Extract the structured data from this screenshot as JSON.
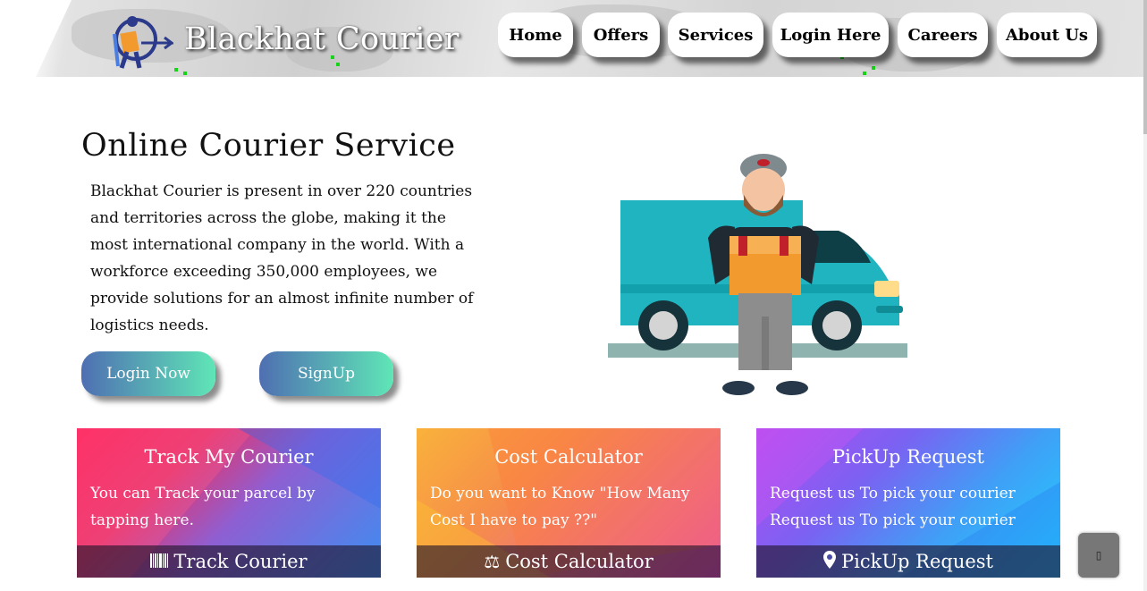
{
  "header": {
    "brand": "Blackhat Courier",
    "logo_icon": "courier-logo-icon",
    "nav": [
      {
        "label": "Home"
      },
      {
        "label": "Offers"
      },
      {
        "label": "Services"
      },
      {
        "label": "Login Here"
      },
      {
        "label": "Careers"
      },
      {
        "label": "About Us"
      }
    ]
  },
  "hero": {
    "title": "Online Courier Service",
    "text": "Blackhat Courier is present in over 220 countries and territories across the globe, making it the most international company in the world. With a workforce exceeding 350,000 employees, we provide solutions for an almost infinite number of logistics needs.",
    "login_label": "Login Now",
    "signup_label": "SignUp",
    "illustration": "delivery-man-with-van"
  },
  "cards": [
    {
      "title": "Track My Courier",
      "text": "You can Track your parcel by tapping here.",
      "action_label": "Track Courier",
      "icon": "barcode-icon"
    },
    {
      "title": "Cost Calculator",
      "text": "Do you want to Know \"How Many Cost I have to pay ??\"",
      "action_label": "Cost Calculator",
      "icon": "balance-scale-icon"
    },
    {
      "title": "PickUp Request",
      "text": "Request us To pick your courier Request us To pick your courier",
      "action_label": "PickUp Request",
      "icon": "map-marker-icon"
    }
  ],
  "colors": {
    "cta_gradient_start": "#4f6fb2",
    "cta_gradient_end": "#5fe6b6",
    "van": "#1fb4c0"
  }
}
